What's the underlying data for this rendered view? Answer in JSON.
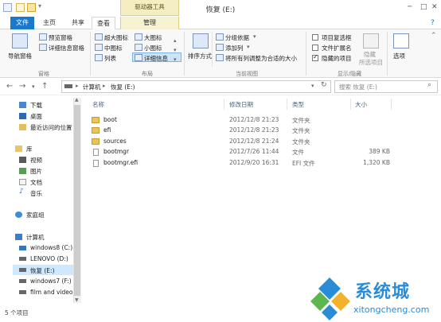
{
  "window": {
    "title": "恢复 (E:)",
    "context_tab_label": "驱动器工具"
  },
  "tabs": {
    "file": "文件",
    "home": "主页",
    "share": "共享",
    "view": "查看",
    "manage": "管理"
  },
  "ribbon": {
    "pane": {
      "nav_pane": "导航窗格",
      "preview_pane": "预览窗格",
      "details_pane": "详细信息窗格",
      "group": "窗格"
    },
    "layout": {
      "xlarge": "超大图标",
      "large": "大图标",
      "medium": "中图标",
      "small": "小图标",
      "list": "列表",
      "details": "详细信息",
      "group": "布局"
    },
    "current_view": {
      "sort": "排序方式",
      "group_by": "分组依据",
      "add_col": "添加列",
      "fit_cols": "将所有列调整为合适的大小",
      "group": "当前视图"
    },
    "show_hide": {
      "item_checkboxes": "项目复选框",
      "file_ext": "文件扩展名",
      "hidden_items": "隐藏的项目",
      "hide_selected_1": "隐藏",
      "hide_selected_2": "所选项目",
      "options": "选项",
      "group": "显示/隐藏"
    },
    "checks": {
      "item_checkboxes": false,
      "file_ext": false,
      "hidden_items": true
    }
  },
  "address": {
    "computer": "计算机",
    "drive": "恢复 (E:)",
    "search_placeholder": "搜索 恢复 (E:)"
  },
  "sidebar": {
    "favorites": [
      "下载",
      "桌面",
      "最近访问的位置"
    ],
    "libraries_title": "库",
    "libraries": [
      "视频",
      "图片",
      "文档",
      "音乐"
    ],
    "homegroup": "家庭组",
    "computer_title": "计算机",
    "drives": [
      "windows8 (C:)",
      "LENOVO (D:)",
      "恢复 (E:)",
      "windows7 (F:)",
      "film and video"
    ]
  },
  "columns": {
    "name": "名称",
    "date": "修改日期",
    "type": "类型",
    "size": "大小"
  },
  "files": [
    {
      "name": "boot",
      "date": "2012/12/8 21:23",
      "type": "文件夹",
      "size": "",
      "kind": "folder"
    },
    {
      "name": "efi",
      "date": "2012/12/8 21:23",
      "type": "文件夹",
      "size": "",
      "kind": "folder"
    },
    {
      "name": "sources",
      "date": "2012/12/8 21:24",
      "type": "文件夹",
      "size": "",
      "kind": "folder"
    },
    {
      "name": "bootmgr",
      "date": "2012/7/26 11:44",
      "type": "文件",
      "size": "389 KB",
      "kind": "file"
    },
    {
      "name": "bootmgr.efi",
      "date": "2012/9/20 16:31",
      "type": "EFI 文件",
      "size": "1,320 KB",
      "kind": "file"
    }
  ],
  "status": {
    "count": "5 个项目"
  },
  "watermark": {
    "brand": "系统城",
    "url": "xitongcheng.com"
  },
  "colors": {
    "accent": "#1979ca",
    "folder": "#e9c45b",
    "watermark_blue": "#2a8bd6"
  }
}
